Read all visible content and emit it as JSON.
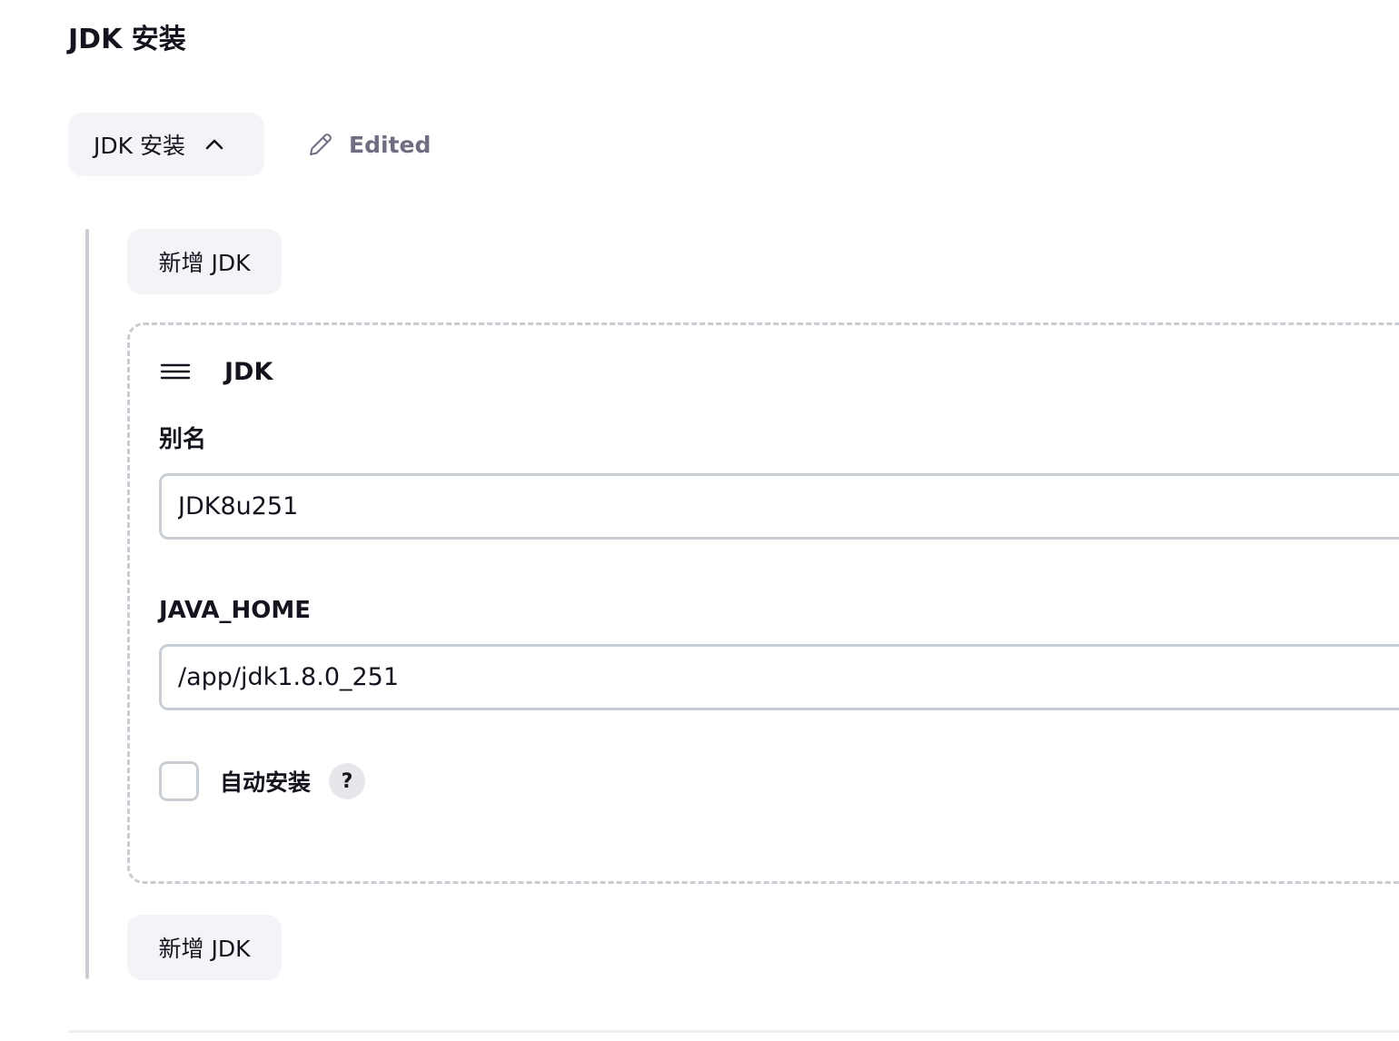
{
  "section": {
    "title": "JDK 安装"
  },
  "toggle": {
    "label": "JDK 安装",
    "icon": "chevron-up-icon"
  },
  "status": {
    "edited_label": "Edited",
    "icon": "pencil-icon"
  },
  "add_buttons": {
    "top_label": "新增 JDK",
    "bottom_label": "新增 JDK"
  },
  "jdk_item": {
    "title": "JDK",
    "handle_icon": "drag-handle-icon",
    "alias": {
      "label": "别名",
      "value": "JDK8u251"
    },
    "java_home": {
      "label": "JAVA_HOME",
      "value": "/app/jdk1.8.0_251"
    },
    "auto_install": {
      "label": "自动安装",
      "checked": false,
      "help_label": "?"
    }
  },
  "colors": {
    "text": "#14141f",
    "muted": "#6e6e80",
    "border": "#c9ced4",
    "button_bg": "#f3f4f7"
  }
}
